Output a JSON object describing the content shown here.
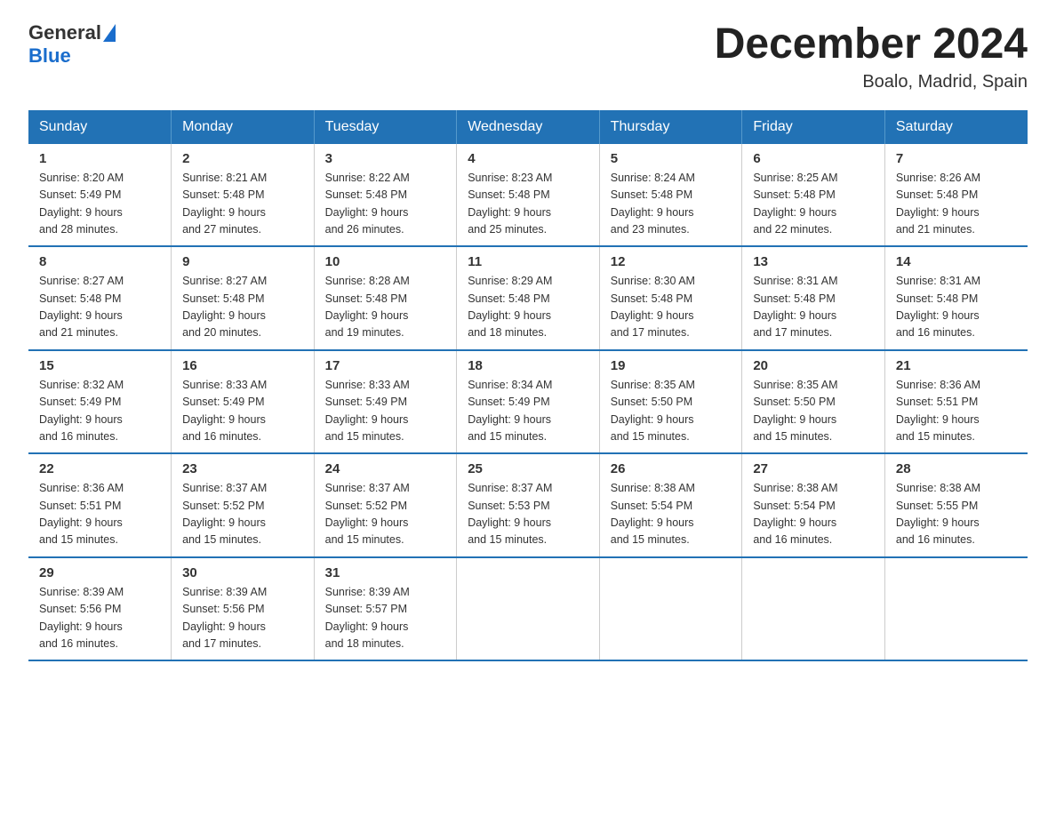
{
  "logo": {
    "general": "General",
    "blue": "Blue"
  },
  "title": "December 2024",
  "location": "Boalo, Madrid, Spain",
  "days_of_week": [
    "Sunday",
    "Monday",
    "Tuesday",
    "Wednesday",
    "Thursday",
    "Friday",
    "Saturday"
  ],
  "weeks": [
    [
      {
        "day": "1",
        "sunrise": "8:20 AM",
        "sunset": "5:49 PM",
        "daylight": "9 hours and 28 minutes."
      },
      {
        "day": "2",
        "sunrise": "8:21 AM",
        "sunset": "5:48 PM",
        "daylight": "9 hours and 27 minutes."
      },
      {
        "day": "3",
        "sunrise": "8:22 AM",
        "sunset": "5:48 PM",
        "daylight": "9 hours and 26 minutes."
      },
      {
        "day": "4",
        "sunrise": "8:23 AM",
        "sunset": "5:48 PM",
        "daylight": "9 hours and 25 minutes."
      },
      {
        "day": "5",
        "sunrise": "8:24 AM",
        "sunset": "5:48 PM",
        "daylight": "9 hours and 23 minutes."
      },
      {
        "day": "6",
        "sunrise": "8:25 AM",
        "sunset": "5:48 PM",
        "daylight": "9 hours and 22 minutes."
      },
      {
        "day": "7",
        "sunrise": "8:26 AM",
        "sunset": "5:48 PM",
        "daylight": "9 hours and 21 minutes."
      }
    ],
    [
      {
        "day": "8",
        "sunrise": "8:27 AM",
        "sunset": "5:48 PM",
        "daylight": "9 hours and 21 minutes."
      },
      {
        "day": "9",
        "sunrise": "8:27 AM",
        "sunset": "5:48 PM",
        "daylight": "9 hours and 20 minutes."
      },
      {
        "day": "10",
        "sunrise": "8:28 AM",
        "sunset": "5:48 PM",
        "daylight": "9 hours and 19 minutes."
      },
      {
        "day": "11",
        "sunrise": "8:29 AM",
        "sunset": "5:48 PM",
        "daylight": "9 hours and 18 minutes."
      },
      {
        "day": "12",
        "sunrise": "8:30 AM",
        "sunset": "5:48 PM",
        "daylight": "9 hours and 17 minutes."
      },
      {
        "day": "13",
        "sunrise": "8:31 AM",
        "sunset": "5:48 PM",
        "daylight": "9 hours and 17 minutes."
      },
      {
        "day": "14",
        "sunrise": "8:31 AM",
        "sunset": "5:48 PM",
        "daylight": "9 hours and 16 minutes."
      }
    ],
    [
      {
        "day": "15",
        "sunrise": "8:32 AM",
        "sunset": "5:49 PM",
        "daylight": "9 hours and 16 minutes."
      },
      {
        "day": "16",
        "sunrise": "8:33 AM",
        "sunset": "5:49 PM",
        "daylight": "9 hours and 16 minutes."
      },
      {
        "day": "17",
        "sunrise": "8:33 AM",
        "sunset": "5:49 PM",
        "daylight": "9 hours and 15 minutes."
      },
      {
        "day": "18",
        "sunrise": "8:34 AM",
        "sunset": "5:49 PM",
        "daylight": "9 hours and 15 minutes."
      },
      {
        "day": "19",
        "sunrise": "8:35 AM",
        "sunset": "5:50 PM",
        "daylight": "9 hours and 15 minutes."
      },
      {
        "day": "20",
        "sunrise": "8:35 AM",
        "sunset": "5:50 PM",
        "daylight": "9 hours and 15 minutes."
      },
      {
        "day": "21",
        "sunrise": "8:36 AM",
        "sunset": "5:51 PM",
        "daylight": "9 hours and 15 minutes."
      }
    ],
    [
      {
        "day": "22",
        "sunrise": "8:36 AM",
        "sunset": "5:51 PM",
        "daylight": "9 hours and 15 minutes."
      },
      {
        "day": "23",
        "sunrise": "8:37 AM",
        "sunset": "5:52 PM",
        "daylight": "9 hours and 15 minutes."
      },
      {
        "day": "24",
        "sunrise": "8:37 AM",
        "sunset": "5:52 PM",
        "daylight": "9 hours and 15 minutes."
      },
      {
        "day": "25",
        "sunrise": "8:37 AM",
        "sunset": "5:53 PM",
        "daylight": "9 hours and 15 minutes."
      },
      {
        "day": "26",
        "sunrise": "8:38 AM",
        "sunset": "5:54 PM",
        "daylight": "9 hours and 15 minutes."
      },
      {
        "day": "27",
        "sunrise": "8:38 AM",
        "sunset": "5:54 PM",
        "daylight": "9 hours and 16 minutes."
      },
      {
        "day": "28",
        "sunrise": "8:38 AM",
        "sunset": "5:55 PM",
        "daylight": "9 hours and 16 minutes."
      }
    ],
    [
      {
        "day": "29",
        "sunrise": "8:39 AM",
        "sunset": "5:56 PM",
        "daylight": "9 hours and 16 minutes."
      },
      {
        "day": "30",
        "sunrise": "8:39 AM",
        "sunset": "5:56 PM",
        "daylight": "9 hours and 17 minutes."
      },
      {
        "day": "31",
        "sunrise": "8:39 AM",
        "sunset": "5:57 PM",
        "daylight": "9 hours and 18 minutes."
      },
      null,
      null,
      null,
      null
    ]
  ],
  "labels": {
    "sunrise": "Sunrise:",
    "sunset": "Sunset:",
    "daylight": "Daylight:"
  }
}
